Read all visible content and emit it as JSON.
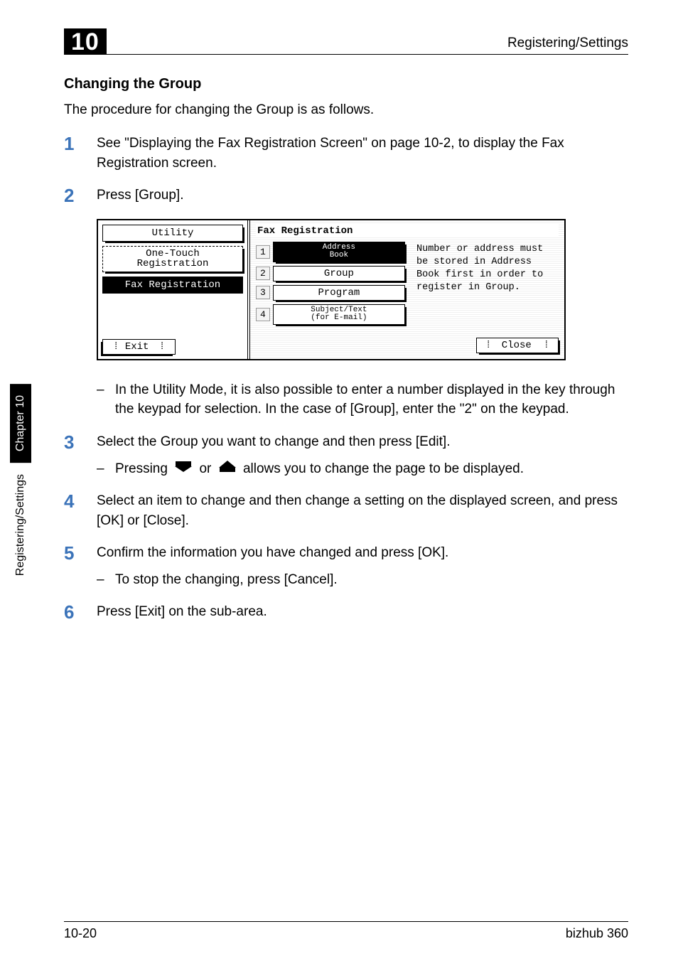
{
  "header": {
    "chapter_number": "10",
    "doc_section": "Registering/Settings"
  },
  "side_tab": {
    "dark": "Chapter 10",
    "light": "Registering/Settings"
  },
  "section": {
    "title": "Changing the Group",
    "intro": "The procedure for changing the Group is as follows."
  },
  "steps": {
    "s1": {
      "num": "1",
      "text": "See \"Displaying the Fax Registration Screen\" on page 10-2, to display the Fax Registration screen."
    },
    "s2": {
      "num": "2",
      "text": "Press [Group]."
    },
    "s2_sub": "In the Utility Mode, it is also possible to enter a number displayed in the key through the keypad for selection. In the case of [Group], enter the \"2\" on the keypad.",
    "s3": {
      "num": "3",
      "text": "Select the Group you want to change and then press [Edit]."
    },
    "s3_sub_pre": "Pressing ",
    "s3_sub_mid": " or ",
    "s3_sub_post": " allows you to change the page to be displayed.",
    "s4": {
      "num": "4",
      "text": "Select an item to change and then change a setting on the displayed screen, and press [OK] or [Close]."
    },
    "s5": {
      "num": "5",
      "text": "Confirm the information you have changed and press [OK]."
    },
    "s5_sub": "To stop the changing, press [Cancel].",
    "s6": {
      "num": "6",
      "text": "Press [Exit] on the sub-area."
    }
  },
  "fax": {
    "left": {
      "utility": "Utility",
      "one_touch_line1": "One-Touch",
      "one_touch_line2": "Registration",
      "fax_reg": "Fax Registration",
      "exit": "Exit"
    },
    "right": {
      "title": "Fax Registration",
      "opts": [
        {
          "n": "1",
          "label_line1": "Address",
          "label_line2": "Book"
        },
        {
          "n": "2",
          "label": "Group"
        },
        {
          "n": "3",
          "label": "Program"
        },
        {
          "n": "4",
          "label_line1": "Subject/Text",
          "label_line2": "(for E-mail)"
        }
      ],
      "help": "Number or address must be stored in Address Book first in order to register in Group.",
      "close": "Close"
    }
  },
  "footer": {
    "left": "10-20",
    "right": "bizhub 360"
  }
}
